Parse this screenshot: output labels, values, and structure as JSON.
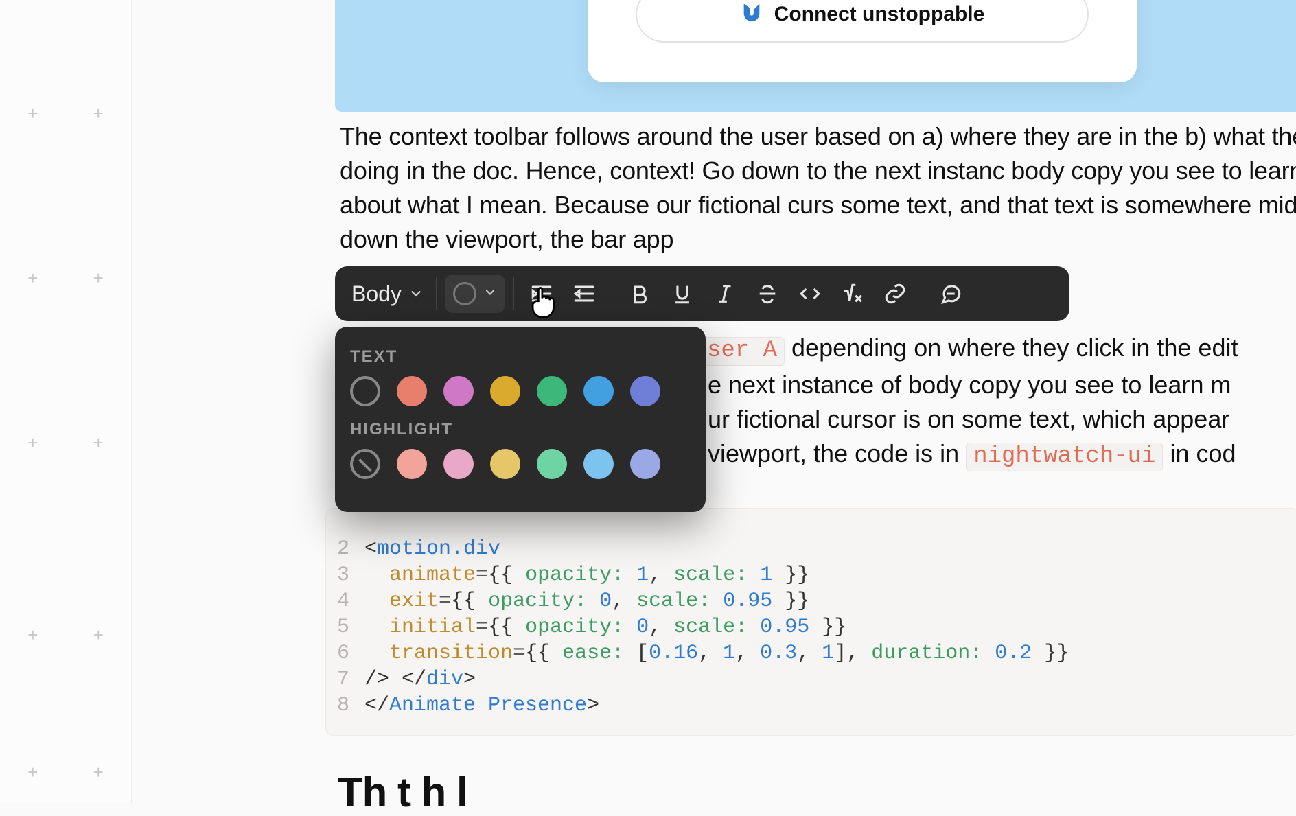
{
  "banner": {
    "connect_label": "Connect unstoppable"
  },
  "paragraph1": "The context toolbar follows around the user based on a) where they are in the b) what they are doing in the doc. Hence, context! Go down to the next instanc body copy you see to learn more about what I mean. Because our fictional curs some text, and that text is somewhere midway down the viewport, the bar app",
  "toolbar": {
    "style_label": "Body"
  },
  "color_popover": {
    "text_label": "TEXT",
    "highlight_label": "HIGHLIGHT",
    "text_colors": [
      "#3a3a3a",
      "#e77f6c",
      "#cf79c6",
      "#d9aa2e",
      "#3eb87a",
      "#42a0e0",
      "#6f7fd8"
    ],
    "highlight_colors": [
      "none",
      "#f2a39a",
      "#e9a9c6",
      "#e5c76a",
      "#6fd4a3",
      "#7cc4ee",
      "#9ba8e6"
    ]
  },
  "paragraph2": {
    "code1": "ser A",
    "t1": " depending on where they click in the edit",
    "t2": "e next instance of body copy you see to learn m",
    "t3": "ur fictional cursor is on some text, which appear",
    "t4a": "viewport, the code is in ",
    "code2": "nightwatch-ui",
    "t4b": " in cod"
  },
  "code": {
    "lines": [
      {
        "n": "2",
        "html": "&lt;<span class='tok-tag'>motion.div</span>"
      },
      {
        "n": "3",
        "html": "  <span class='tok-attr'>animate</span><span class='tok-punct'>=</span>{{ <span class='tok-key'>opacity:</span> <span class='tok-num'>1</span>, <span class='tok-key'>scale:</span> <span class='tok-num'>1</span> }}"
      },
      {
        "n": "4",
        "html": "  <span class='tok-attr'>exit</span><span class='tok-punct'>=</span>{{ <span class='tok-key'>opacity:</span> <span class='tok-num'>0</span>, <span class='tok-key'>scale:</span> <span class='tok-num'>0.95</span> }}"
      },
      {
        "n": "5",
        "html": "  <span class='tok-attr'>initial</span><span class='tok-punct'>=</span>{{ <span class='tok-key'>opacity:</span> <span class='tok-num'>0</span>, <span class='tok-key'>scale:</span> <span class='tok-num'>0.95</span> }}"
      },
      {
        "n": "6",
        "html": "  <span class='tok-attr'>transition</span><span class='tok-punct'>=</span>{{ <span class='tok-key'>ease:</span> [<span class='tok-num'>0.16</span>, <span class='tok-num'>1</span>, <span class='tok-num'>0.3</span>, <span class='tok-num'>1</span>], <span class='tok-key'>duration:</span> <span class='tok-num'>0.2</span> }}"
      },
      {
        "n": "7",
        "html": "/&gt; &lt;/<span class='tok-tag'>div</span>&gt;"
      },
      {
        "n": "8",
        "html": "&lt;/<span class='tok-tag'>Animate Presence</span>&gt;"
      }
    ]
  },
  "heading_cut": "Th   t    h    l"
}
